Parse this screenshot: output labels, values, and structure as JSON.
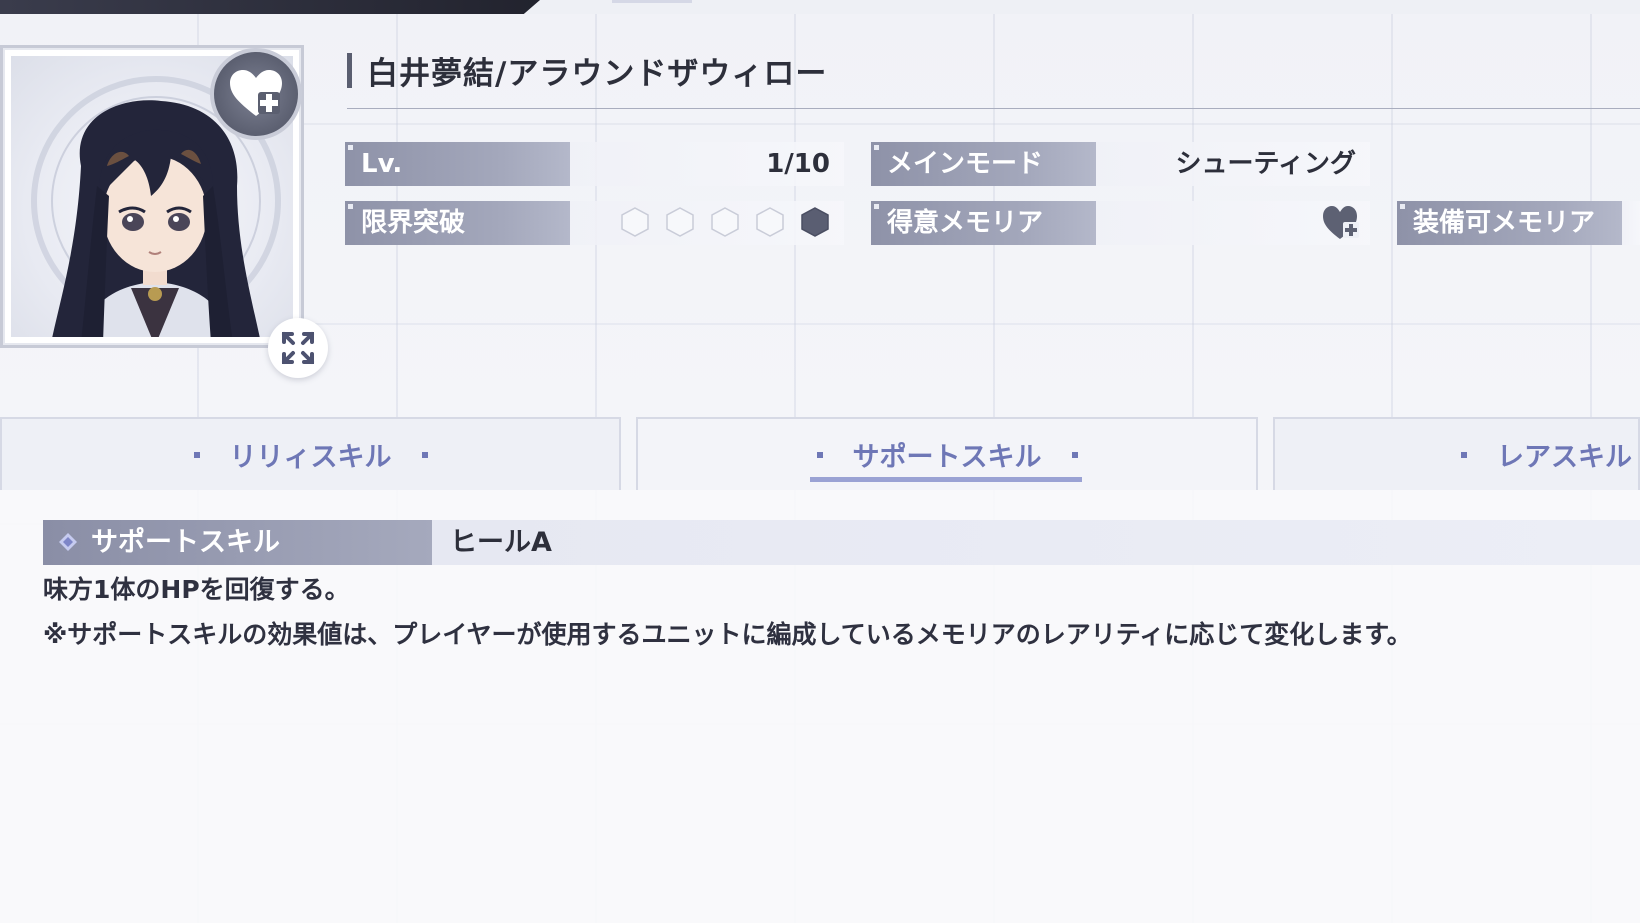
{
  "character": {
    "name": "白井夢結/アラウンドザウィロー"
  },
  "stats": {
    "level_label": "Lv.",
    "level_value": "1/10",
    "limit_break_label": "限界突破",
    "limit_break_filled": 1,
    "limit_break_total": 5,
    "main_mode_label": "メインモード",
    "main_mode_value": "シューティング",
    "specialty_label": "得意メモリア",
    "equippable_label": "装備可メモリア"
  },
  "tabs": [
    {
      "label": "リリィスキル",
      "active": false
    },
    {
      "label": "サポートスキル",
      "active": true
    },
    {
      "label": "レアスキル",
      "active": false
    }
  ],
  "skill": {
    "type_label": "サポートスキル",
    "name": "ヒールA",
    "description_1": "味方1体のHPを回復する。",
    "description_2": "※サポートスキルの効果値は、プレイヤーが使用するユニットに編成しているメモリアのレアリティに応じて変化します。"
  },
  "colors": {
    "accent": "#6e77b6",
    "label_bg": "#9a9eb4",
    "text": "#2d2f3b"
  }
}
